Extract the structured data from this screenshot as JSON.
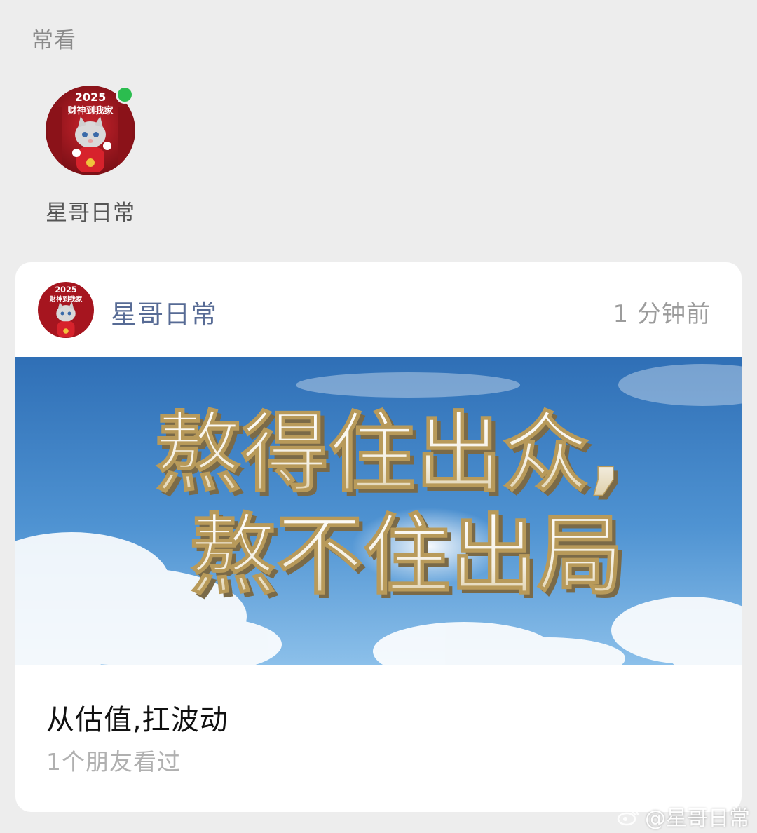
{
  "section": {
    "title": "常看"
  },
  "frequent": {
    "name": "星哥日常",
    "avatar_text": {
      "year": "2025",
      "caption": "财神到我家"
    },
    "online_color": "#2bbd4f"
  },
  "article": {
    "account": "星哥日常",
    "time": "1 分钟前",
    "cover_text": {
      "line1": "熬得住出众,",
      "line2": "熬不住出局"
    },
    "title": "从估值,扛波动",
    "viewed": "1个朋友看过"
  },
  "watermark": {
    "text": "@星哥日常",
    "icon": "weibo-icon"
  },
  "colors": {
    "background": "#ededed",
    "account_link": "#576b95",
    "muted": "#9c9c9c"
  }
}
